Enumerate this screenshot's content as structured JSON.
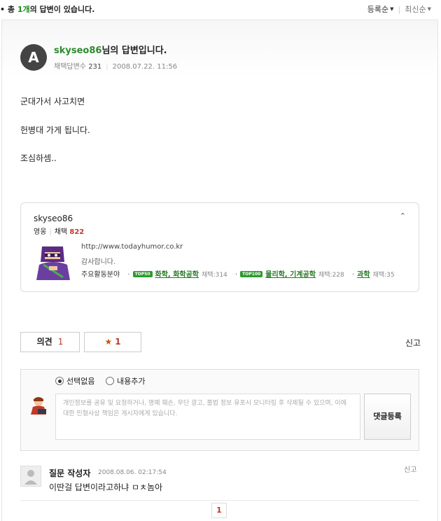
{
  "header": {
    "total_prefix": "• 총 ",
    "total_count": "1개",
    "total_suffix": "의 답변이 있습니다.",
    "sort_registered": "등록순",
    "sort_latest": "최신순"
  },
  "answer": {
    "avatar_letter": "A",
    "author_id": "skyseo86",
    "title_suffix": "님의 답변입니다.",
    "adopted_label": "채택답변수",
    "adopted_count": "231",
    "datetime": "2008.07.22. 11:56",
    "lines": [
      "군대가서 사고치면",
      "헌병대 가게 됩니다.",
      "조심하셈.."
    ]
  },
  "profile": {
    "name": "skyseo86",
    "rank": "영웅",
    "adopt_label": "채택",
    "adopt_count": "822",
    "url": "http://www.todayhumor.co.kr",
    "thanks": "감사합니다.",
    "fields_label": "주요활동분야",
    "fields": [
      {
        "badge": "TOP50",
        "name": "화학, 화학공학",
        "count": "채택:314"
      },
      {
        "badge": "TOP100",
        "name": "물리학, 기계공학",
        "count": "채택:228"
      },
      {
        "badge": "",
        "name": "과학",
        "count": "채택:35"
      }
    ]
  },
  "actions": {
    "opinion_label": "의견",
    "opinion_count": "1",
    "like_count": "1",
    "report_label": "신고"
  },
  "comment_form": {
    "option_none": "선택없음",
    "option_add": "내용추가",
    "placeholder": "개인정보를 공유 및 요청하거나, 명예 훼손, 무단 광고, 불법 정보 유포시 모니터링 후 삭제될 수 있으며, 이에 대한 민형사상 책임은 게시자에게 있습니다.",
    "submit_label": "댓글등록"
  },
  "comments": [
    {
      "author": "질문 작성자",
      "date": "2008.08.06. 02:17:54",
      "text": "이딴걸 답변이라고하냐 ㅁㅊ놈아",
      "report": "신고"
    }
  ],
  "pagination": {
    "current": "1"
  }
}
